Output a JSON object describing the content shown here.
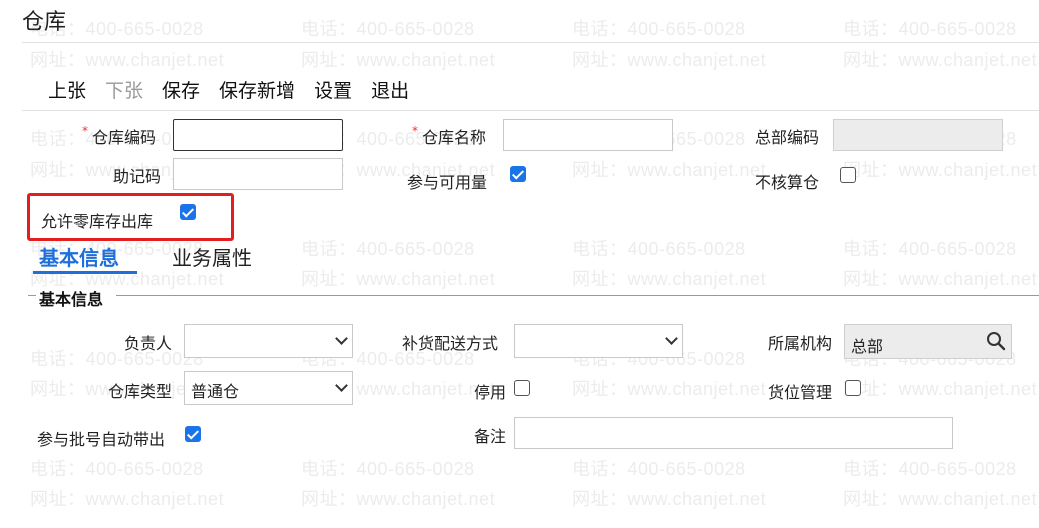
{
  "page": {
    "title": "仓库"
  },
  "watermark": {
    "phone": "电话：400-665-0028",
    "site": "网址：www.chanjet.net"
  },
  "toolbar": {
    "items": [
      "上张",
      "下张",
      "保存",
      "保存新增",
      "设置",
      "退出"
    ]
  },
  "form": {
    "warehouse_code_label": "仓库编码",
    "warehouse_name_label": "仓库名称",
    "hq_code_label": "总部编码",
    "mnemonic_label": "助记码",
    "available_qty_label": "参与可用量",
    "no_costing_label": "不核算仓",
    "allow_zero_stock_label": "允许零库存出库"
  },
  "tabs": [
    "基本信息",
    "业务属性"
  ],
  "section": {
    "title": "基本信息"
  },
  "basic": {
    "manager_label": "负责人",
    "replenish_label": "补货配送方式",
    "org_label": "所属机构",
    "org_value": "总部",
    "type_label": "仓库类型",
    "type_value": "普通仓",
    "disable_label": "停用",
    "location_label": "货位管理",
    "batch_label": "参与批号自动带出",
    "remark_label": "备注"
  },
  "colors": {
    "accent": "#1e6fd9",
    "checkbox": "#1a73e8",
    "highlight": "#e41e1e",
    "required": "#e33333"
  }
}
